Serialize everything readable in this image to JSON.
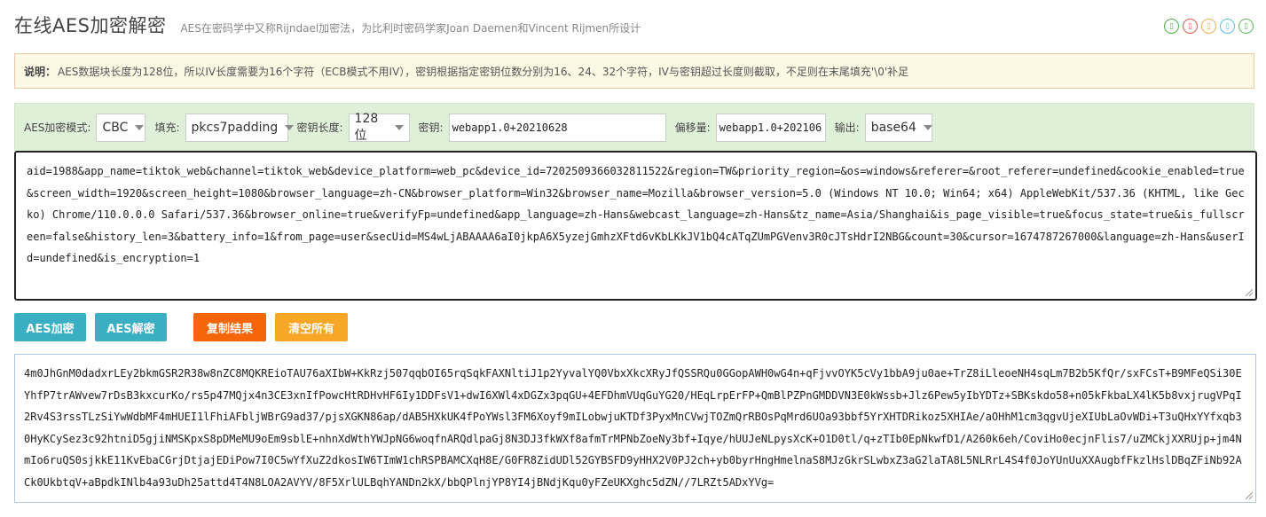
{
  "header": {
    "title": "在线AES加密解密",
    "subtitle": "AES在密码学中又称Rijndael加密法，为比利时密码学家Joan Daemen和Vincent Rijmen所设计"
  },
  "share_icons": [
    {
      "name": "share-icon-1",
      "color": "#4cae4c"
    },
    {
      "name": "share-icon-2",
      "color": "#e4584b"
    },
    {
      "name": "share-icon-3",
      "color": "#f0ad4e"
    },
    {
      "name": "share-icon-4",
      "color": "#5bc0de"
    },
    {
      "name": "share-icon-5",
      "color": "#5cb85c"
    }
  ],
  "notice": {
    "label": "说明：",
    "text": "AES数据块长度为128位，所以IV长度需要为16个字符（ECB模式不用IV），密钥根据指定密钥位数分别为16、24、32个字符，IV与密钥超过长度则截取，不足则在末尾填充'\\0'补足"
  },
  "options": {
    "mode_label": "AES加密模式:",
    "mode_value": "CBC",
    "padding_label": "填充:",
    "padding_value": "pkcs7padding",
    "keylen_label": "密钥长度:",
    "keylen_value": "128位",
    "key_label": "密钥:",
    "key_value": "webapp1.0+20210628",
    "iv_label": "偏移量:",
    "iv_value": "webapp1.0+202106",
    "output_label": "输出:",
    "output_value": "base64"
  },
  "input_text": "aid=1988&app_name=tiktok_web&channel=tiktok_web&device_platform=web_pc&device_id=7202509366032811522&region=TW&priority_region=&os=windows&referer=&root_referer=undefined&cookie_enabled=true&screen_width=1920&screen_height=1080&browser_language=zh-CN&browser_platform=Win32&browser_name=Mozilla&browser_version=5.0 (Windows NT 10.0; Win64; x64) AppleWebKit/537.36 (KHTML, like Gecko) Chrome/110.0.0.0 Safari/537.36&browser_online=true&verifyFp=undefined&app_language=zh-Hans&webcast_language=zh-Hans&tz_name=Asia/Shanghai&is_page_visible=true&focus_state=true&is_fullscreen=false&history_len=3&battery_info=1&from_page=user&secUid=MS4wLjABAAAA6aI0jkpA6X5yzejGmhzXFtd6vKbLKkJV1bQ4cATqZUmPGVenv3R0cJTsHdrI2NBG&count=30&cursor=1674787267000&language=zh-Hans&userId=undefined&is_encryption=1",
  "buttons": {
    "encrypt": {
      "label": "AES加密",
      "color": "#3aafc4"
    },
    "decrypt": {
      "label": "AES解密",
      "color": "#3aafc4"
    },
    "copy": {
      "label": "复制结果",
      "color": "#f5650a"
    },
    "clear": {
      "label": "清空所有",
      "color": "#f7a626"
    }
  },
  "output_text": "4m0JhGnM0dadxrLEy2bkmGSR2R38w8nZC8MQKREioTAU76aXIbW+KkRzj507qqbOI65rqSqkFAXNltiJ1p2YyvalYQ0VbxXkcXRyJfQSSRQu0GGopAWH0wG4n+qFjvvOYK5cVy1bbA9ju0ae+TrZ8iLleoeNH4sqLm7B2b5KfQr/sxFCsT+B9MFeQSi30EYhfP7trAWvew7rDsB3kxcurKo/rs5p47MQjx4n3CE3xnIfPowcHtRDHvHF6Iy1DDFsV1+dwI6XWl4xDGZx3pqGU+4EFDhmVUqGuYG20/HEqLrpErFP+QmBlPZPnGMDDVN3E0kWssb+Jlz6Pew5yIbYDTz+SBKskdo58+n05kFkbaLX4lK5b8vxjrugVPqI2Rv4S3rssTLzSiYwWdbMF4mHUEI1lFhiAFbljWBrG9ad37/pjsXGKN86ap/dAB5HXkUK4fPoYWsl3FM6Xoyf9mILobwjuKTDf3PyxMnCVwjTOZmQrRBOsPqMrd6UOa93bbf5YrXHTDRikoz5XHIAe/aOHhM1cm3qgvUjeXIUbLaOvWDi+T3uQHxYYfxqb30HyKCySez3c92htniD5gjiNMSKpxS8pDMeMU9oEm9sblE+nhnXdWthYWJpNG6woqfnARQdlpaGj8N3DJ3fkWXf8afmTrMPNbZoeNy3bf+Iqye/hUUJeNLpysXcK+O1D0tl/q+zTIb0EpNkwfD1/A260k6eh/CoviHo0ecjnFlis7/uZMCkjXXRUjp+jm4NmIo6ruQS0sjkkE11KvEbaCGrjDtjajEDiPow7I0C5wYfXuZ2dkosIW6TImW1chRSPBAMCXqH8E/G0FR8ZidUDl52GYBSFD9yHHX2V0PJ2ch+yb0byrHngHmelnaS8MJzGkrSLwbxZ3aG2laTA8L5NLRrL4S4f0JoYUnUuXXAugbfFkzlHslDBqZFiNb92ACk0UkbtqV+aBpdkINlb4a93uDh25attd4T4N8LOA2AVYV/8F5XrlULBqhYANDn2kX/bbQPlnjYP8YI4jBNdjKqu0yFZeUKXghc5dZN//7LRZt5ADxYVg="
}
